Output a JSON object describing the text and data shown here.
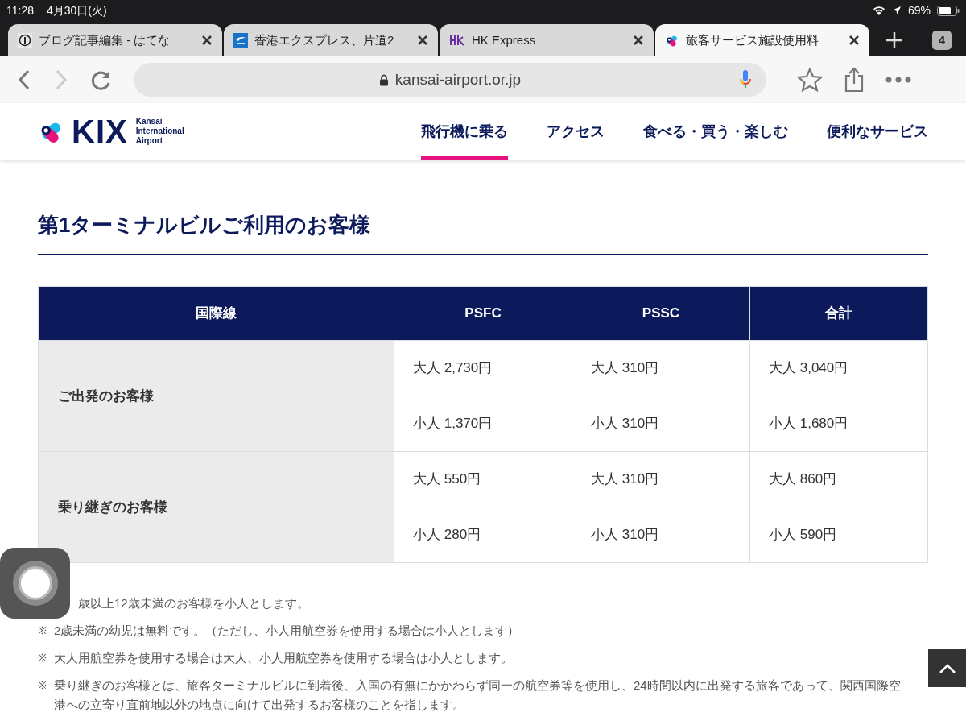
{
  "status_bar": {
    "time": "11:28",
    "date": "4月30日(火)",
    "battery": "69%"
  },
  "tabs": [
    {
      "title": "ブログ記事編集 - はてな",
      "selected": false
    },
    {
      "title": "香港エクスプレス、片道2",
      "selected": false
    },
    {
      "title": "HK Express",
      "selected": false
    },
    {
      "title": "旅客サービス施設使用料",
      "selected": true
    }
  ],
  "tab_count": "4",
  "address_bar": {
    "url": "kansai-airport.or.jp"
  },
  "site_header": {
    "logo": "KIX",
    "logo_sub": [
      "Kansai",
      "International",
      "Airport"
    ],
    "nav": [
      {
        "label": "飛行機に乗る",
        "selected": true
      },
      {
        "label": "アクセス",
        "selected": false
      },
      {
        "label": "食べる・買う・楽しむ",
        "selected": false
      },
      {
        "label": "便利なサービス",
        "selected": false
      }
    ]
  },
  "heading": "第1ターミナルビルご利用のお客様",
  "table": {
    "columns": [
      "国際線",
      "PSFC",
      "PSSC",
      "合計"
    ],
    "groups": [
      {
        "label": "ご出発のお客様",
        "rows": [
          [
            "大人 2,730円",
            "大人 310円",
            "大人 3,040円"
          ],
          [
            "小人 1,370円",
            "小人 310円",
            "小人 1,680円"
          ]
        ]
      },
      {
        "label": "乗り継ぎのお客様",
        "rows": [
          [
            "大人 550円",
            "大人 310円",
            "大人 860円"
          ],
          [
            "小人 280円",
            "小人 310円",
            "小人 590円"
          ]
        ]
      }
    ]
  },
  "notes": [
    {
      "kind": "covered",
      "text": "歳以上12歳未満のお客様を小人とします。"
    },
    {
      "kind": "note",
      "mark": "※",
      "text": "2歳未満の幼児は無料です。（ただし、小人用航空券を使用する場合は小人とします）"
    },
    {
      "kind": "note",
      "mark": "※",
      "text": "大人用航空券を使用する場合は大人、小人用航空券を使用する場合は小人とします。"
    },
    {
      "kind": "note",
      "mark": "※",
      "text": "乗り継ぎのお客様とは、旅客ターミナルビルに到着後、入国の有無にかかわらず同一の航空券等を使用し、24時間以内に出発する旅客であって、関西国際空港への立寄り直前地以外の地点に向けて出発するお客様のことを指します。"
    }
  ]
}
